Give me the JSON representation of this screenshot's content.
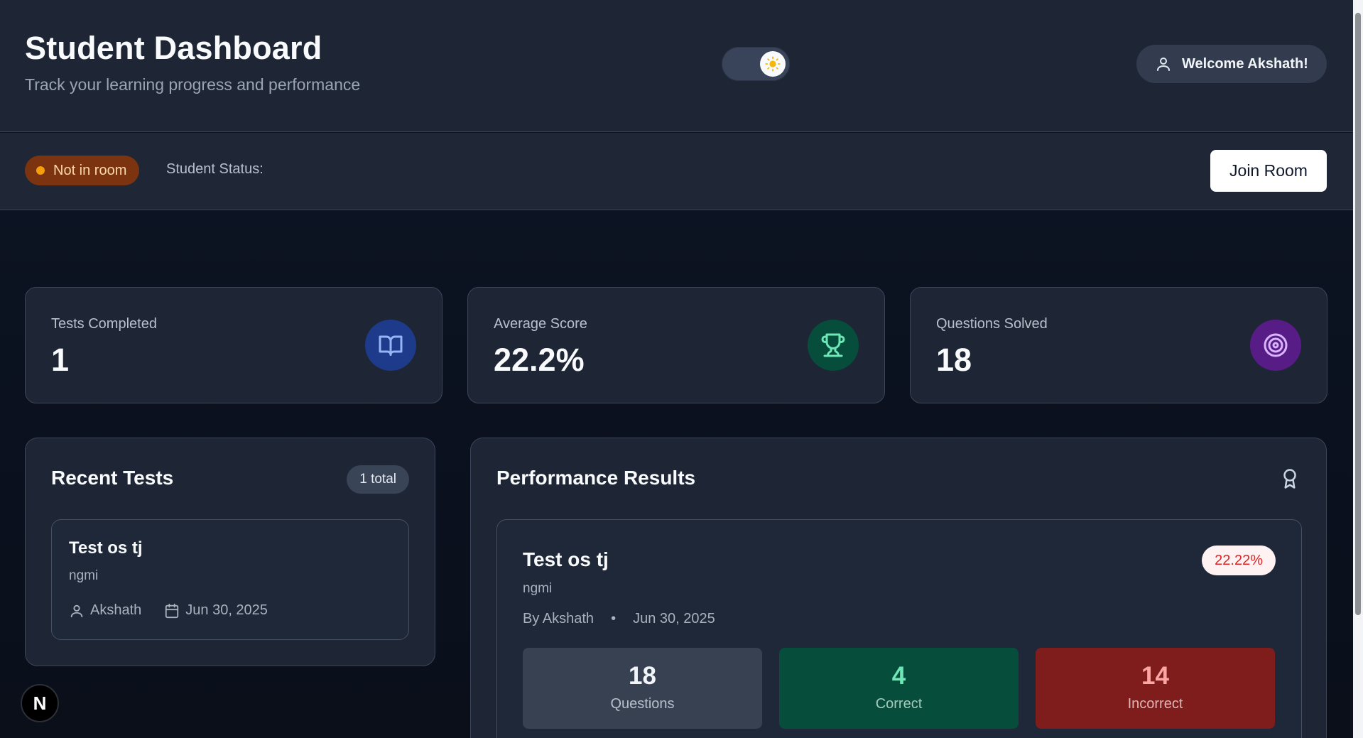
{
  "header": {
    "title": "Student Dashboard",
    "subtitle": "Track your learning progress and performance",
    "welcome": "Welcome Akshath!"
  },
  "status": {
    "badge": "Not in room",
    "label": "Student Status:",
    "join_button": "Join Room"
  },
  "stats": [
    {
      "label": "Tests Completed",
      "value": "1",
      "icon": "book-open-icon"
    },
    {
      "label": "Average Score",
      "value": "22.2%",
      "icon": "trophy-icon"
    },
    {
      "label": "Questions Solved",
      "value": "18",
      "icon": "target-icon"
    }
  ],
  "recent_tests": {
    "title": "Recent Tests",
    "total": "1 total",
    "items": [
      {
        "name": "Test os tj",
        "description": "ngmi",
        "author": "Akshath",
        "date": "Jun 30, 2025"
      }
    ]
  },
  "performance": {
    "title": "Performance Results",
    "result": {
      "name": "Test os tj",
      "description": "ngmi",
      "by": "By Akshath",
      "separator": "•",
      "date": "Jun 30, 2025",
      "percent": "22.22%",
      "metrics": [
        {
          "value": "18",
          "label": "Questions"
        },
        {
          "value": "4",
          "label": "Correct"
        },
        {
          "value": "14",
          "label": "Incorrect"
        }
      ]
    }
  },
  "next_indicator": "N",
  "colors": {
    "status_badge_bg": "#7c3410",
    "status_dot": "#f59e0b",
    "book_icon_bg": "#1e3a8a",
    "trophy_icon_bg": "#064e3b",
    "target_icon_bg": "#581c87",
    "correct_bg": "#064e3b",
    "incorrect_bg": "#7f1d1d",
    "percent_text": "#dc2626"
  }
}
